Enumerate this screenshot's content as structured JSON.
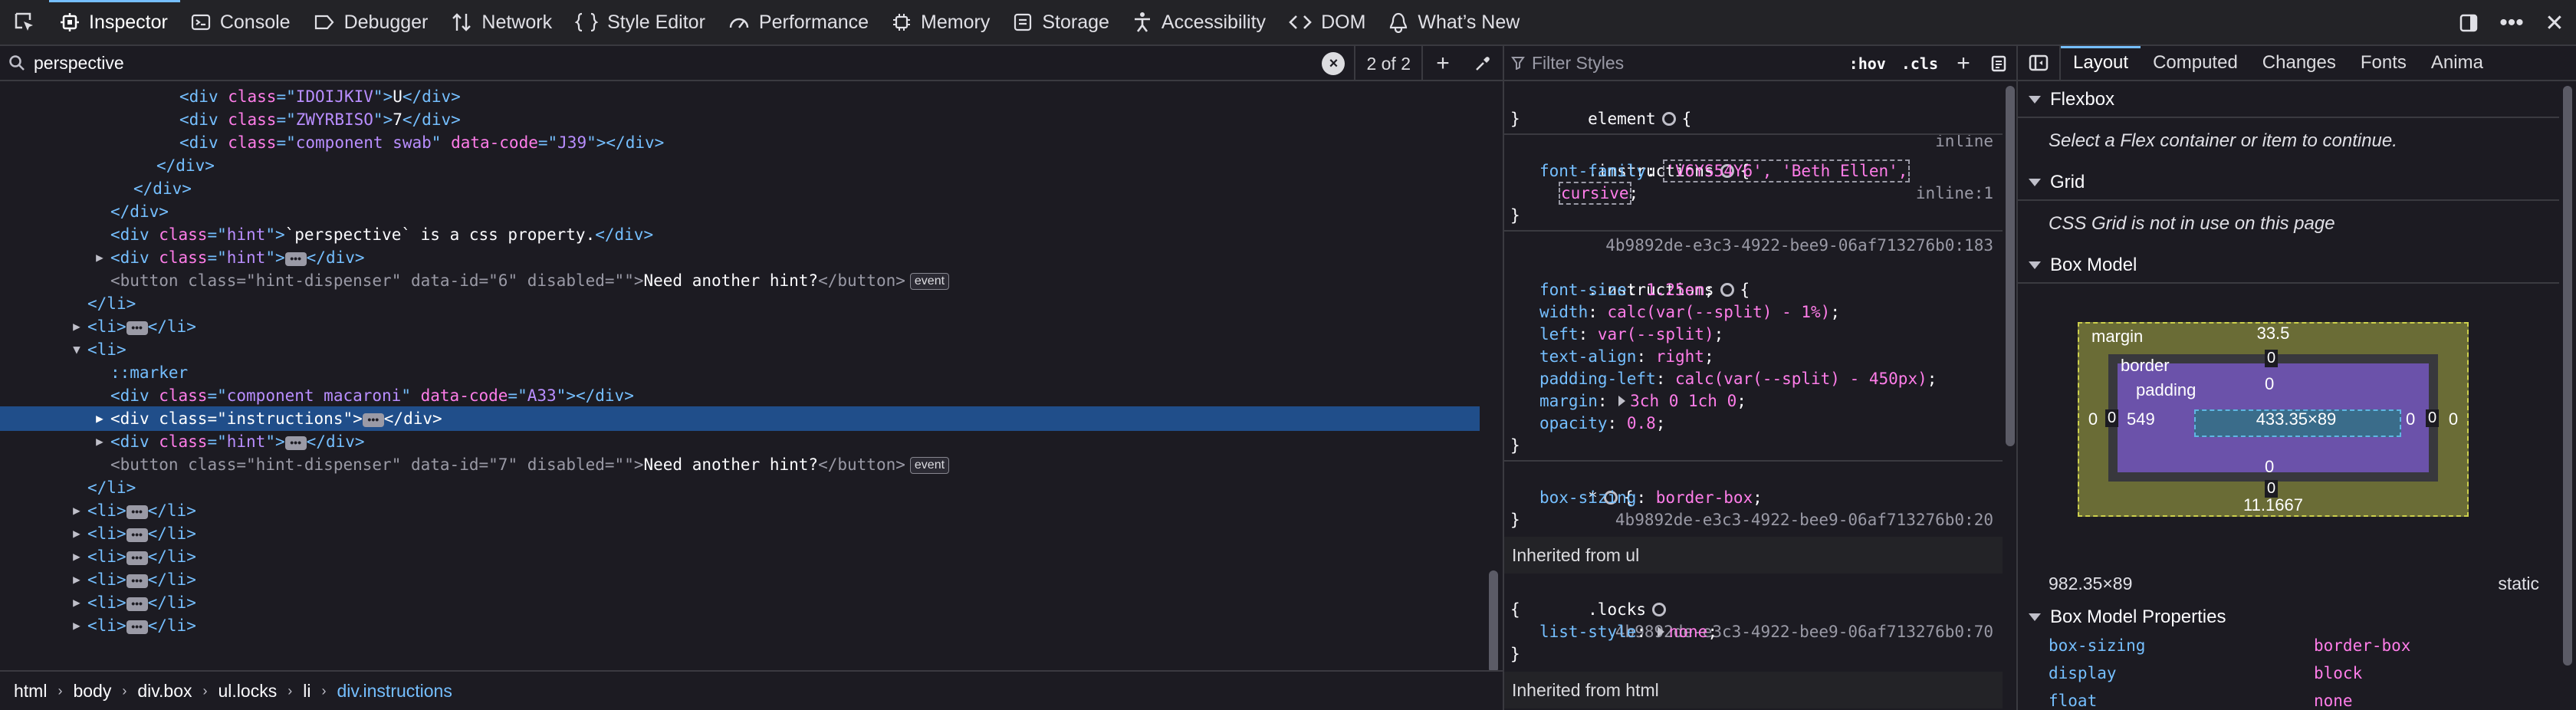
{
  "toolbar": {
    "tabs": [
      {
        "label": "Inspector",
        "icon": "inspector-icon",
        "active": true
      },
      {
        "label": "Console",
        "icon": "console-icon"
      },
      {
        "label": "Debugger",
        "icon": "debugger-icon"
      },
      {
        "label": "Network",
        "icon": "network-icon"
      },
      {
        "label": "Style Editor",
        "icon": "style-editor-icon"
      },
      {
        "label": "Performance",
        "icon": "performance-icon"
      },
      {
        "label": "Memory",
        "icon": "memory-icon"
      },
      {
        "label": "Storage",
        "icon": "storage-icon"
      },
      {
        "label": "Accessibility",
        "icon": "accessibility-icon"
      },
      {
        "label": "DOM",
        "icon": "dom-icon"
      },
      {
        "label": "What’s New",
        "icon": "whats-new-icon"
      }
    ],
    "right_icons": [
      "dock-icon",
      "more-icon",
      "close-icon"
    ]
  },
  "search": {
    "value": "perspective",
    "result_count": "2 of 2"
  },
  "tree": {
    "lines": [
      {
        "i": 6,
        "t": "div",
        "cls": "IDOIJKIV",
        "text": "U"
      },
      {
        "i": 6,
        "t": "div",
        "cls": "ZWYRBISO",
        "text": "7"
      },
      {
        "i": 6,
        "t": "div",
        "cls": "component swab",
        "dc": "J39"
      },
      {
        "i": 5,
        "close": "div"
      },
      {
        "i": 4,
        "close": "div"
      },
      {
        "i": 3,
        "close": "div"
      },
      {
        "i": 3,
        "t": "div",
        "cls": "hint",
        "text": "`perspective` is a css property."
      },
      {
        "i": 3,
        "t": "div",
        "cls": "hint",
        "collapsed": true
      },
      {
        "i": 3,
        "t": "button",
        "cls": "hint-dispenser",
        "did": "6",
        "text": "Need another hint?",
        "dim": true,
        "badge": "event"
      },
      {
        "i": 2,
        "close": "li"
      },
      {
        "i": 2,
        "t": "li",
        "collapsed": true
      },
      {
        "i": 2,
        "t": "li",
        "open": true
      },
      {
        "i": 3,
        "pseudo": "::marker"
      },
      {
        "i": 3,
        "t": "div",
        "cls": "component macaroni",
        "dc": "A33"
      },
      {
        "i": 3,
        "t": "div",
        "cls": "instructions",
        "collapsed": true,
        "selected": true
      },
      {
        "i": 3,
        "t": "div",
        "cls": "hint",
        "collapsed": true
      },
      {
        "i": 3,
        "t": "button",
        "cls": "hint-dispenser",
        "did": "7",
        "text": "Need another hint?",
        "dim": true,
        "badge": "event"
      },
      {
        "i": 2,
        "close": "li"
      },
      {
        "i": 2,
        "t": "li",
        "collapsed": true
      },
      {
        "i": 2,
        "t": "li",
        "collapsed": true
      },
      {
        "i": 2,
        "t": "li",
        "collapsed": true
      },
      {
        "i": 2,
        "t": "li",
        "collapsed": true
      },
      {
        "i": 2,
        "t": "li",
        "collapsed": true
      },
      {
        "i": 2,
        "t": "li",
        "collapsed": true
      }
    ]
  },
  "breadcrumb": [
    "html",
    "body",
    "div.box",
    "ul.locks",
    "li",
    "div.instructions"
  ],
  "rules_pane": {
    "filter_placeholder": "Filter Styles",
    "hov": ":hov",
    "cls": ".cls",
    "element_rule": {
      "selector": "element",
      "source": "inline"
    },
    "rule1": {
      "selector": ".instructions",
      "source": "inline:1",
      "font_family_name": "font-family",
      "font_family_value": "'V6YS54Y6', 'Beth Ellen',",
      "font_family_value2": "cursive"
    },
    "rule2": {
      "selector": ".instructions",
      "source": "4b9892de-e3c3-4922-bee9-06af713276b0:183",
      "props": [
        {
          "name": "font-size",
          "value": "1.25em"
        },
        {
          "name": "width",
          "value": "calc(var(--split) - 1%)"
        },
        {
          "name": "left",
          "value": "var(--split)"
        },
        {
          "name": "text-align",
          "value": "right"
        },
        {
          "name": "padding-left",
          "value": "calc(var(--split) - 450px)"
        },
        {
          "name": "margin",
          "value": "3ch 0 1ch 0"
        },
        {
          "name": "opacity",
          "value": "0.8"
        }
      ]
    },
    "rule3": {
      "selector": "*",
      "source": "4b9892de-e3c3-4922-bee9-06af713276b0:20",
      "prop_name": "box-sizing",
      "prop_value": "border-box"
    },
    "inherited_ul": "Inherited from ul",
    "rule4": {
      "selector": ".locks",
      "source": "4b9892de-e3c3-4922-bee9-06af713276b0:70",
      "prop_name": "list-style",
      "prop_value": "none"
    },
    "inherited_html": "Inherited from html"
  },
  "layout_pane": {
    "tabs": [
      "Layout",
      "Computed",
      "Changes",
      "Fonts",
      "Anima"
    ],
    "flexbox_title": "Flexbox",
    "flexbox_note": "Select a Flex container or item to continue.",
    "grid_title": "Grid",
    "grid_note": "CSS Grid is not in use on this page",
    "boxmodel_title": "Box Model",
    "box": {
      "margin_label": "margin",
      "border_label": "border",
      "padding_label": "padding",
      "margin_top": "33.5",
      "margin_bottom": "11.1667",
      "margin_left": "0",
      "margin_right": "0",
      "border_top": "0",
      "border_bottom": "0",
      "border_left": "0",
      "border_right": "0",
      "padding_top": "0",
      "padding_bottom": "0",
      "padding_left": "549",
      "padding_right": "0",
      "content": "433.35×89"
    },
    "dims": "982.35×89",
    "position": "static",
    "props_title": "Box Model Properties",
    "props": [
      {
        "name": "box-sizing",
        "value": "border-box"
      },
      {
        "name": "display",
        "value": "block"
      },
      {
        "name": "float",
        "value": "none"
      }
    ]
  }
}
